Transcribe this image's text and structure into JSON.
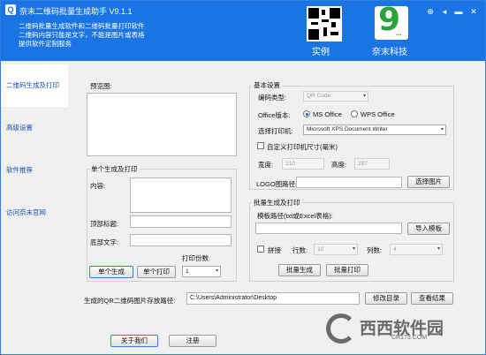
{
  "window": {
    "title": "奈末二维码批量生成助手 V9.1.1",
    "app_icon": "qr-app-icon"
  },
  "header": {
    "desc_lines": [
      "二维码批量生成软件和二维码批量打印软件",
      "二维码内容只能是文字，不能是图片或表格",
      "提供软件定制服务"
    ],
    "qr_label": "实例",
    "logo_label": "奈末科技",
    "logo_text": "9",
    "logo_dots": "..."
  },
  "window_controls": {
    "pin": "⊕",
    "restore": "◂",
    "minimize": "▬",
    "close": "✕"
  },
  "sidebar": {
    "items": [
      {
        "label": "二维码生成及打印"
      },
      {
        "label": "高级设置"
      },
      {
        "label": "软件推荐"
      },
      {
        "label": "访问奈末官网"
      }
    ]
  },
  "preview": {
    "label": "预览图:"
  },
  "single": {
    "title": "单个生成及打印",
    "content_label": "内容:",
    "top_title_label": "顶部标题:",
    "bottom_text_label": "底部文字:",
    "copies_label": "打印份数:",
    "copies_value": "1",
    "generate_btn": "单个生成",
    "print_btn": "单个打印"
  },
  "settings": {
    "title": "基本设置",
    "code_type_label": "编码类型:",
    "code_type_value": "QR Code",
    "office_label": "Office版本:",
    "office_ms": "MS Office",
    "office_wps": "WPS Office",
    "printer_label": "选择打印机:",
    "printer_value": "Microsoft XPS Document Writer",
    "custom_size_label": "自定义打印机尺寸(毫米)",
    "width_label": "宽度:",
    "width_value": "210",
    "height_label": "高度:",
    "height_value": "297",
    "logo_label": "LOGO图路径:",
    "logo_btn": "选择图片"
  },
  "batch": {
    "title": "批量生成及打印",
    "template_label": "模板路径(txt或Excel表格):",
    "import_btn": "导入模板",
    "tile_label": "拼接",
    "rows_label": "行数:",
    "rows_value": "10",
    "cols_label": "列数:",
    "cols_value": "4",
    "generate_btn": "批量生成",
    "print_btn": "批量打印"
  },
  "save": {
    "label": "生成的QR二维码图片存放路径:",
    "path": "C:\\Users\\Administrator\\Desktop",
    "modify_btn": "修改目录",
    "view_btn": "查看结果"
  },
  "footer": {
    "about_btn": "关于我们",
    "register_btn": "注册"
  },
  "watermark": {
    "main": "西西软件园",
    "sub": "CR173.COM"
  },
  "colors": {
    "header_blue": "#1a74e4",
    "link_blue": "#1a4fb4",
    "logo_green": "#2aa33a"
  }
}
